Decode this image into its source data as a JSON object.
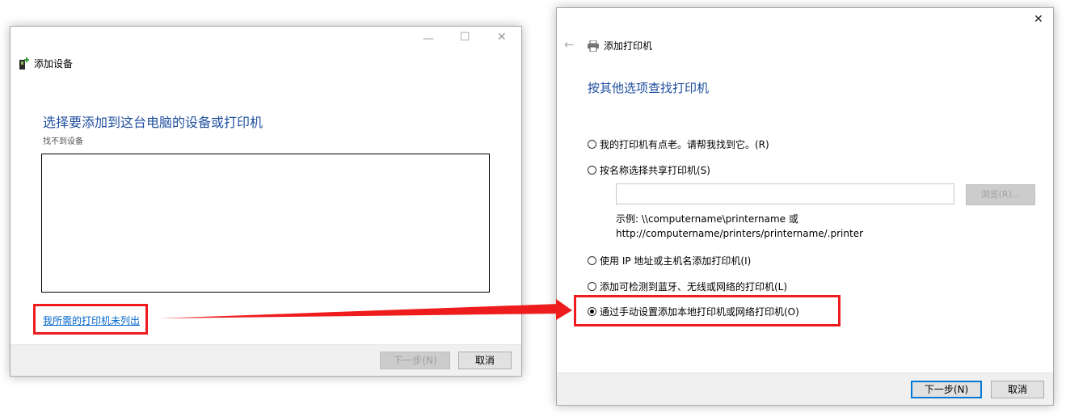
{
  "add_device_dialog": {
    "title": "添加设备",
    "heading": "选择要添加到这台电脑的设备或打印机",
    "status": "找不到设备",
    "printer_not_listed_link": "我所需的打印机未列出",
    "next_button": "下一步(N)",
    "cancel_button": "取消"
  },
  "add_printer_dialog": {
    "title": "添加打印机",
    "heading": "按其他选项查找打印机",
    "options": [
      {
        "label": "我的打印机有点老。请帮我找到它。(R)",
        "checked": false
      },
      {
        "label": "按名称选择共享打印机(S)",
        "checked": false
      },
      {
        "label": "使用 IP 地址或主机名添加打印机(I)",
        "checked": false
      },
      {
        "label": "添加可检测到蓝牙、无线或网络的打印机(L)",
        "checked": false
      },
      {
        "label": "通过手动设置添加本地打印机或网络打印机(O)",
        "checked": true
      }
    ],
    "shared_printer_input": "",
    "browse_button": "浏览(R)...",
    "example_line1": "示例: \\\\computername\\printername 或",
    "example_line2": "http://computername/printers/printername/.printer",
    "next_button": "下一步(N)",
    "cancel_button": "取消"
  },
  "annotation": {
    "color": "#ee1c1c"
  }
}
